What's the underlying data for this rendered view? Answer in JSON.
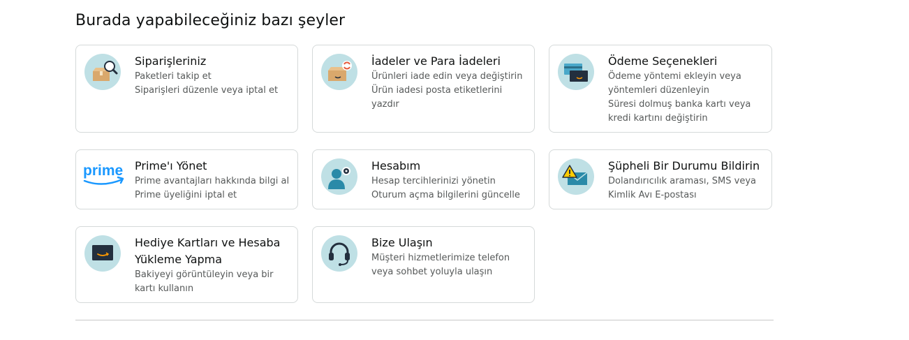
{
  "heading": "Burada yapabileceğiniz bazı şeyler",
  "cards": [
    {
      "title": "Siparişleriniz",
      "lines": [
        "Paketleri takip et",
        "Siparişleri düzenle veya iptal et"
      ],
      "icon": "package-search-icon"
    },
    {
      "title": "İadeler ve Para İadeleri",
      "lines": [
        "Ürünleri iade edin veya değiştirin",
        "Ürün iadesi posta etiketlerini",
        "yazdır"
      ],
      "icon": "package-return-icon"
    },
    {
      "title": "Ödeme Seçenekleri",
      "lines": [
        "Ödeme yöntemi ekleyin veya",
        "yöntemleri düzenleyin",
        "Süresi dolmuş banka kartı veya",
        "kredi kartını değiştirin"
      ],
      "icon": "payment-cards-icon"
    },
    {
      "title": "Prime'ı Yönet",
      "lines": [
        "Prime avantajları hakkında bilgi al",
        "Prime üyeliğini iptal et"
      ],
      "icon": "prime-logo-icon",
      "logo_text": "prime"
    },
    {
      "title": "Hesabım",
      "lines": [
        "Hesap tercihlerinizi yönetin",
        "Oturum açma bilgilerini güncelle"
      ],
      "icon": "account-settings-icon"
    },
    {
      "title": "Şüpheli Bir Durumu Bildirin",
      "lines": [
        "Dolandırıcılık araması, SMS veya",
        "Kimlik Avı E-postası"
      ],
      "icon": "warning-mail-icon"
    },
    {
      "title": "Hediye Kartları ve Hesaba Yükleme Yapma",
      "lines": [
        "Bakiyeyi görüntüleyin veya bir",
        "kartı kullanın"
      ],
      "icon": "gift-card-icon"
    },
    {
      "title": "Bize Ulaşın",
      "lines": [
        "Müşteri hizmetlerimize telefon",
        "veya sohbet yoluyla ulaşın"
      ],
      "icon": "headset-icon"
    }
  ],
  "colors": {
    "icon_bg": "#bfe0e5",
    "border": "#d5d9d9",
    "prime_blue": "#1a98ff"
  }
}
